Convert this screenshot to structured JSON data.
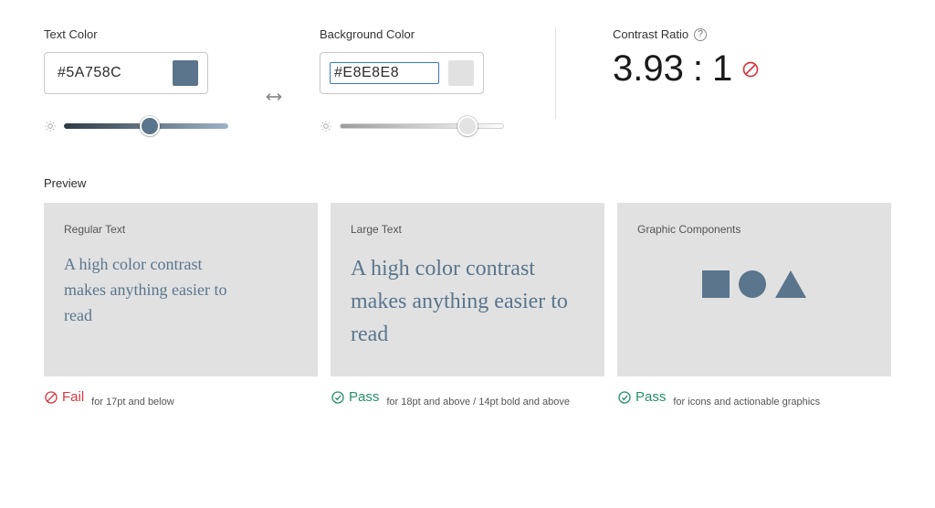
{
  "textColor": {
    "label": "Text Color",
    "hex": "#5A758C",
    "swatch": "#5a758c",
    "slider": {
      "position": 52,
      "gradient_start": "#2e3b46",
      "gradient_end": "#9cb3c7",
      "thumb": "#5a758c"
    }
  },
  "backgroundColor": {
    "label": "Background Color",
    "hex": "#E8E8E8",
    "swatch": "#e1e1e1",
    "slider": {
      "position": 78,
      "gradient_start": "#9b9b9b",
      "gradient_end": "#ffffff",
      "thumb": "#e3e3e3"
    }
  },
  "contrast": {
    "label": "Contrast Ratio",
    "value": "3.93",
    "sep": ":",
    "one": "1",
    "status": "fail"
  },
  "preview": {
    "label": "Preview",
    "sample_text": "A high color contrast makes anything easier to read",
    "cards": {
      "regular": {
        "title": "Regular Text"
      },
      "large": {
        "title": "Large Text"
      },
      "graphic": {
        "title": "Graphic Components"
      }
    },
    "results": {
      "regular": {
        "status": "Fail",
        "desc": "for 17pt and below",
        "pass": false
      },
      "large": {
        "status": "Pass",
        "desc": "for 18pt and above / 14pt bold and above",
        "pass": true
      },
      "graphic": {
        "status": "Pass",
        "desc": "for icons and actionable graphics",
        "pass": true
      }
    }
  }
}
